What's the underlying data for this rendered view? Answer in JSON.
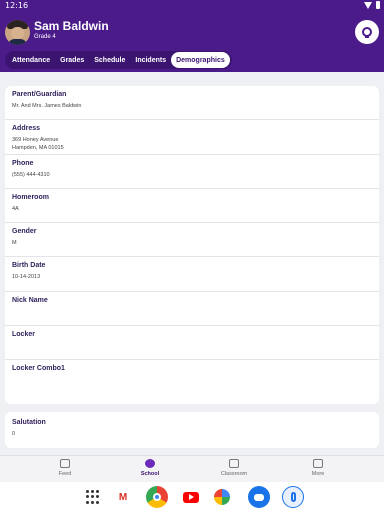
{
  "status_bar": {
    "time": "12:16"
  },
  "header": {
    "student_name": "Sam Baldwin",
    "grade": "Grade 4",
    "switch_icon": "account-switch-icon"
  },
  "tabs": [
    {
      "label": "Attendance",
      "active": false
    },
    {
      "label": "Grades",
      "active": false
    },
    {
      "label": "Schedule",
      "active": false
    },
    {
      "label": "Incidents",
      "active": false
    },
    {
      "label": "Demographics",
      "active": true
    }
  ],
  "demographics": {
    "parent_label": "Parent/Guardian",
    "parent_value": "Mr. And Mrs. James Baldwin",
    "address_label": "Address",
    "address_value": "369 Honey Avenue\nHampden, MA 01015",
    "phone_label": "Phone",
    "phone_value": "(555) 444-4310",
    "homeroom_label": "Homeroom",
    "homeroom_value": "4A",
    "gender_label": "Gender",
    "gender_value": "M",
    "birth_label": "Birth Date",
    "birth_value": "10-14-2013",
    "nick_label": "Nick Name",
    "nick_value": "",
    "locker_label": "Locker",
    "locker_value": "",
    "combo_label": "Locker Combo1",
    "combo_value": "",
    "salutation_label": "Salutation",
    "salutation_value": "0"
  },
  "bottom_nav": {
    "feed": "Feed",
    "school": "School",
    "classroom": "Classroom",
    "more": "More"
  },
  "taskbar": {
    "apps": [
      "app-drawer-icon",
      "gmail-icon",
      "chrome-icon",
      "youtube-icon",
      "photos-icon",
      "messages-icon",
      "phone-icon"
    ]
  },
  "colors": {
    "brand": "#4b1b8a",
    "tab_bar": "#3b1470",
    "accent": "#6c2bbd",
    "background": "#eef0f3"
  }
}
